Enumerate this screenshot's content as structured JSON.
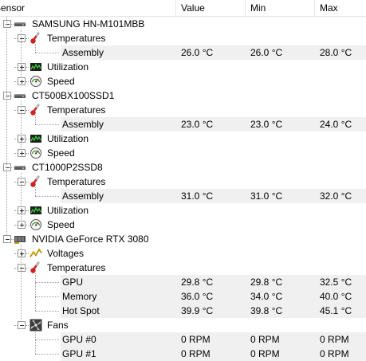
{
  "columns": {
    "sensor": "Sensor",
    "value": "Value",
    "min": "Min",
    "max": "Max"
  },
  "devices": [
    {
      "name": "SAMSUNG HN-M101MBB",
      "icon": "drive-icon",
      "groups": [
        {
          "label": "Temperatures",
          "icon": "thermometer-icon",
          "items": [
            {
              "label": "Assembly",
              "value": "26.0 °C",
              "min": "26.0 °C",
              "max": "28.0 °C"
            }
          ]
        },
        {
          "label": "Utilization",
          "icon": "utilization-graph-icon"
        },
        {
          "label": "Speed",
          "icon": "speedometer-icon"
        }
      ]
    },
    {
      "name": "CT500BX100SSD1",
      "icon": "drive-icon",
      "groups": [
        {
          "label": "Temperatures",
          "icon": "thermometer-icon",
          "items": [
            {
              "label": "Assembly",
              "value": "23.0 °C",
              "min": "23.0 °C",
              "max": "24.0 °C"
            }
          ]
        },
        {
          "label": "Utilization",
          "icon": "utilization-graph-icon"
        },
        {
          "label": "Speed",
          "icon": "speedometer-icon"
        }
      ]
    },
    {
      "name": "CT1000P2SSD8",
      "icon": "drive-icon",
      "groups": [
        {
          "label": "Temperatures",
          "icon": "thermometer-icon",
          "items": [
            {
              "label": "Assembly",
              "value": "31.0 °C",
              "min": "31.0 °C",
              "max": "32.0 °C"
            }
          ]
        },
        {
          "label": "Utilization",
          "icon": "utilization-graph-icon"
        },
        {
          "label": "Speed",
          "icon": "speedometer-icon"
        }
      ]
    },
    {
      "name": "NVIDIA GeForce RTX 3080",
      "icon": "gpu-card-icon",
      "groups": [
        {
          "label": "Voltages",
          "icon": "voltage-icon"
        },
        {
          "label": "Temperatures",
          "icon": "thermometer-icon",
          "items": [
            {
              "label": "GPU",
              "value": "29.8 °C",
              "min": "29.8 °C",
              "max": "32.5 °C"
            },
            {
              "label": "Memory",
              "value": "36.0 °C",
              "min": "34.0 °C",
              "max": "40.0 °C"
            },
            {
              "label": "Hot Spot",
              "value": "39.9 °C",
              "min": "39.8 °C",
              "max": "45.1 °C"
            }
          ]
        },
        {
          "label": "Fans",
          "icon": "fan-icon",
          "items": [
            {
              "label": "GPU #0",
              "value": "0 RPM",
              "min": "0 RPM",
              "max": "0 RPM"
            },
            {
              "label": "GPU #1",
              "value": "0 RPM",
              "min": "0 RPM",
              "max": "0 RPM"
            }
          ]
        }
      ]
    }
  ]
}
